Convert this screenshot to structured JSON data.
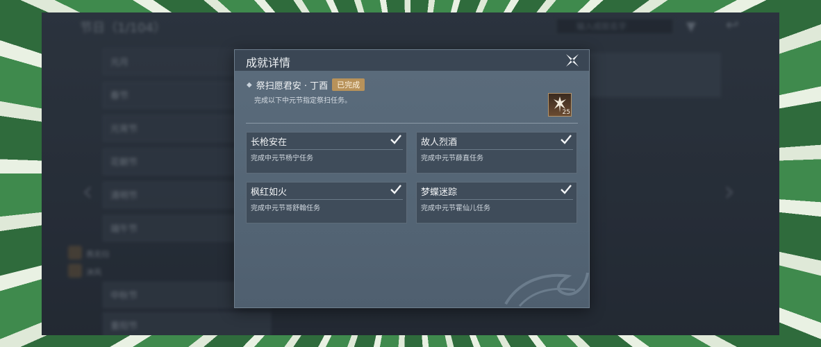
{
  "background": {
    "screen_title": "节日（1/104）",
    "search_placeholder": "输入成就名字",
    "list_rows": [
      "元月",
      "春节",
      "元宵节",
      "花朝节",
      "清明节",
      "端午节",
      "中元节",
      "七夕",
      "中秋节",
      "重阳节"
    ],
    "players": [
      {
        "name": "燕无归"
      },
      {
        "name": "沐风"
      }
    ]
  },
  "modal": {
    "title": "成就详情",
    "achievement": {
      "name": "祭扫愿君安 · 丁酉",
      "status": "已完成",
      "description": "完成以下中元节指定祭扫任务。",
      "reward_icon": "warrior-emblem-icon",
      "reward_count": "25"
    },
    "sub_achievements": [
      {
        "title": "长枪安在",
        "desc": "完成中元节杨宁任务",
        "completed": true
      },
      {
        "title": "故人烈酒",
        "desc": "完成中元节薛直任务",
        "completed": true
      },
      {
        "title": "枫红如火",
        "desc": "完成中元节哥舒翰任务",
        "completed": true
      },
      {
        "title": "梦蝶迷踪",
        "desc": "完成中元节霍仙儿任务",
        "completed": true
      }
    ]
  },
  "colors": {
    "badge": "#b8925a",
    "modal_bg": "#566777",
    "card_bg": "#3f4c5a"
  }
}
